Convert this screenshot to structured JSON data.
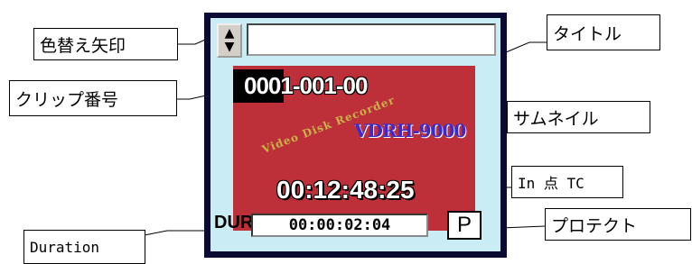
{
  "labels": {
    "color_arrow": "色替え矢印",
    "title": "タイトル",
    "clip_number": "クリップ番号",
    "thumbnail": "サムネイル",
    "in_point_tc": "In 点 TC",
    "protect": "プロテクト",
    "duration": "Duration"
  },
  "clip": {
    "arrow_up": "▲",
    "arrow_down": "▼",
    "title_value": "",
    "clip_number": "0001-001-00",
    "thumbnail_text": "VDRH-9000",
    "thumbnail_diagonal_text": "Video Disk Recorder",
    "in_tc": "00:12:48:25",
    "dur_label": "DUR",
    "duration": "00:00:02:04",
    "protect_label": "P"
  },
  "colors": {
    "frame": "#0a0a32",
    "panel": "#c9ecf5",
    "thumbnail_bg": "#bd303a"
  }
}
